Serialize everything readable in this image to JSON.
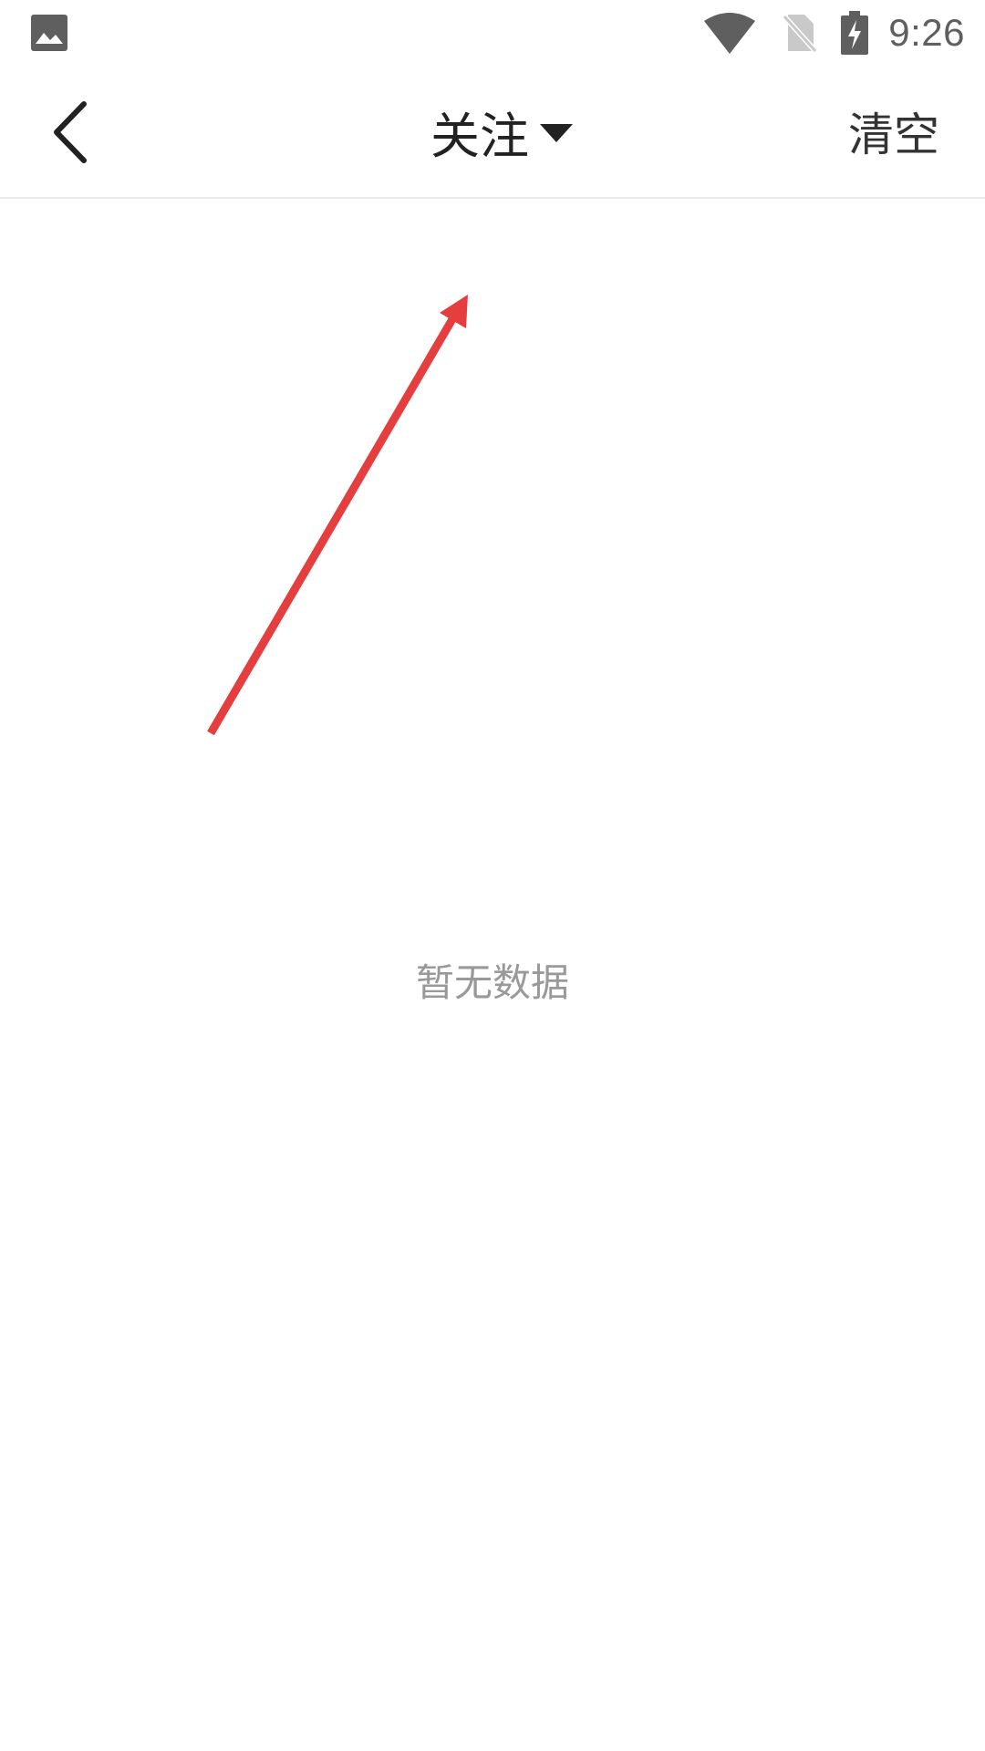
{
  "status_bar": {
    "time": "9:26",
    "icons": [
      "image-icon",
      "wifi-icon",
      "no-sim-icon",
      "battery-charging-icon"
    ]
  },
  "header": {
    "title": "关注",
    "dropdown_icon": "caret-down-icon",
    "back_icon": "chevron-left-icon",
    "clear_label": "清空"
  },
  "content": {
    "empty_message": "暂无数据"
  },
  "colors": {
    "annotation_arrow": "#e53e3e",
    "divider": "#e9e9e9",
    "empty_text": "#999999"
  }
}
